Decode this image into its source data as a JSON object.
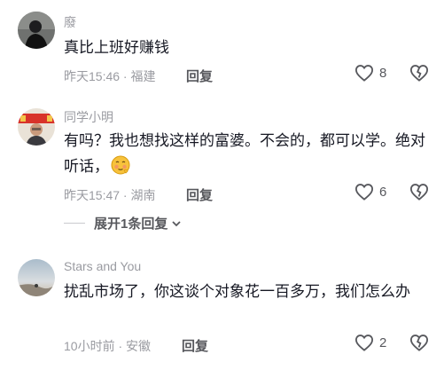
{
  "comments": [
    {
      "username": "廢",
      "text": "真比上班好赚钱",
      "time": "昨天15:46",
      "location": "福建",
      "reply_label": "回复",
      "likes": "8",
      "avatar_icon": "user-avatar-dark"
    },
    {
      "username": "同学小明",
      "text": "有吗？我也想找这样的富婆。不会的，都可以学。绝对听话，",
      "time": "昨天15:47",
      "location": "湖南",
      "reply_label": "回复",
      "likes": "6",
      "expand_label": "展开1条回复",
      "emoji_icon": "shy-blushing-emoji",
      "avatar_icon": "user-avatar-red-banner"
    },
    {
      "username": "Stars and You",
      "text": "扰乱市场了，你这谈个对象花一百多万，我们怎么办",
      "time": "10小时前",
      "location": "安徽",
      "reply_label": "回复",
      "likes": "2",
      "avatar_icon": "user-avatar-sky"
    }
  ],
  "separator": " · ",
  "colors": {
    "text_primary": "#161823",
    "text_secondary": "#9a9ba1",
    "action_gray": "#57585d"
  }
}
